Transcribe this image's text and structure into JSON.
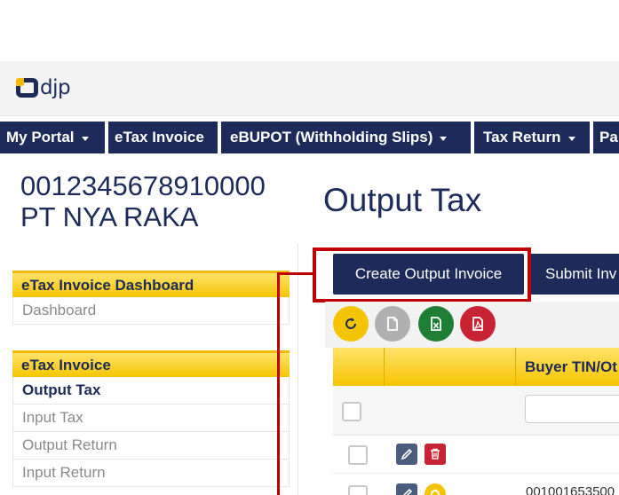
{
  "brand": {
    "logo_text": "djp"
  },
  "nav": [
    {
      "label": "My Portal",
      "has_dropdown": true
    },
    {
      "label": "eTax Invoice",
      "has_dropdown": false
    },
    {
      "label": "eBUPOT (Withholding Slips)",
      "has_dropdown": true
    },
    {
      "label": "Tax Return",
      "has_dropdown": true
    },
    {
      "label": "Pa",
      "has_dropdown": false
    }
  ],
  "company": {
    "tin": "0012345678910000",
    "name": "PT NYA RAKA"
  },
  "page_title": "Output Tax",
  "sidebar": {
    "dashboard_section": {
      "title": "eTax Invoice Dashboard",
      "items": [
        "Dashboard"
      ]
    },
    "invoice_section": {
      "title": "eTax Invoice",
      "items": [
        "Output Tax",
        "Input Tax",
        "Output Return",
        "Input Return"
      ],
      "active": "Output Tax"
    }
  },
  "actions": {
    "create_label": "Create Output Invoice",
    "submit_label": "Submit Inv"
  },
  "toolbar": {
    "icons": [
      "refresh-icon",
      "document-icon",
      "excel-icon",
      "pdf-icon"
    ]
  },
  "table": {
    "columns": [
      "",
      "",
      "Buyer TIN/Ot"
    ],
    "rows": [
      {
        "buyer_tin": ""
      },
      {
        "buyer_tin": "001001653500"
      }
    ]
  },
  "colors": {
    "navy": "#1c2b5a",
    "yellow": "#f5c400",
    "highlight": "#c00000",
    "green": "#1e7e34",
    "red": "#c82333",
    "gray": "#b0b0b0"
  }
}
